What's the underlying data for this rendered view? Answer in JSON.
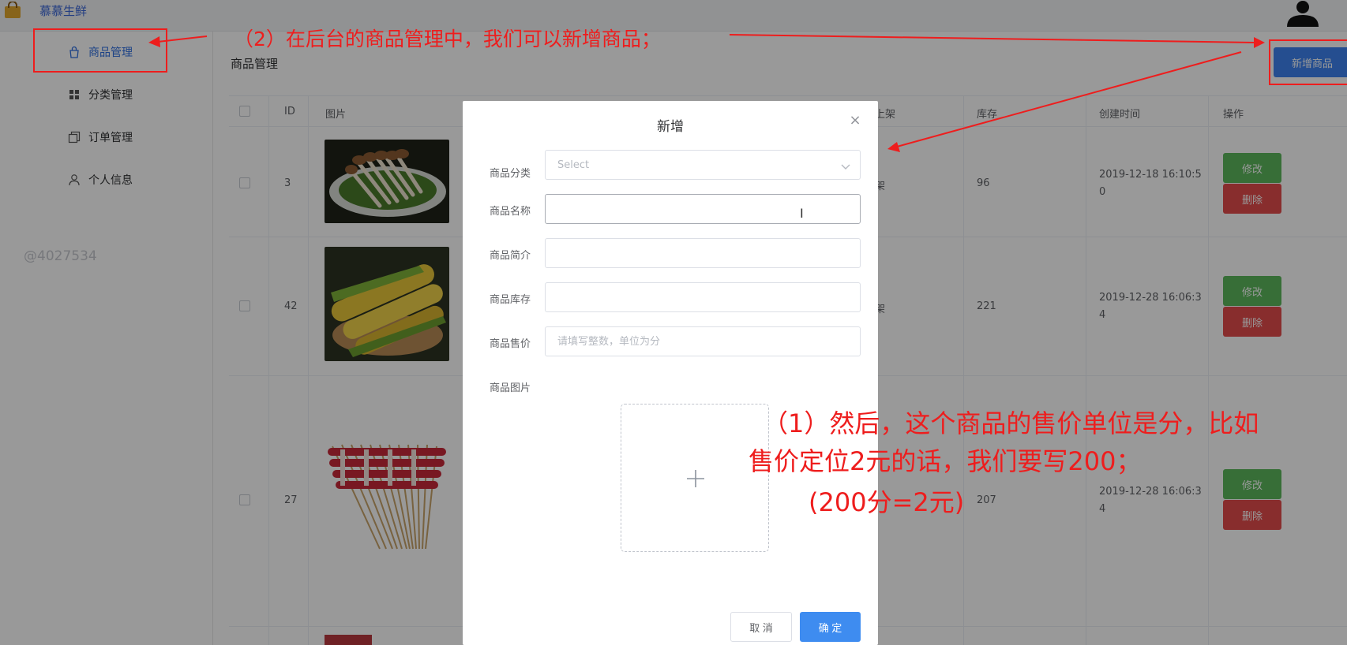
{
  "app": {
    "title": "慕慕生鲜"
  },
  "sidebar": {
    "items": [
      {
        "label": "商品管理",
        "icon": "bag-icon"
      },
      {
        "label": "分类管理",
        "icon": "grid-icon"
      },
      {
        "label": "订单管理",
        "icon": "copy-icon"
      },
      {
        "label": "个人信息",
        "icon": "user-icon"
      }
    ],
    "watermark": "@4027534"
  },
  "main": {
    "title": "商品管理",
    "add_button": "新增商品",
    "columns": [
      "ID",
      "图片",
      "上架",
      "库存",
      "创建时间",
      "操作"
    ],
    "rows": [
      {
        "id": "3",
        "status": "架",
        "stock": "96",
        "created": "2019-12-18 16:10:50",
        "created_lines": [
          "2019-12-18 16:10:5",
          "0"
        ]
      },
      {
        "id": "42",
        "status": "架",
        "stock": "221",
        "created": "2019-12-28 16:06:34",
        "created_lines": [
          "2019-12-28 16:06:3",
          "4"
        ]
      },
      {
        "id": "27",
        "status": "",
        "stock": "207",
        "created": "2019-12-28 16:06:34",
        "created_lines": [
          "2019-12-28 16:06:3",
          "4"
        ]
      }
    ],
    "edit_label": "修改",
    "delete_label": "删除"
  },
  "dialog": {
    "title": "新增",
    "fields": {
      "category": {
        "label": "商品分类",
        "placeholder": "Select"
      },
      "name": {
        "label": "商品名称",
        "value": ""
      },
      "desc": {
        "label": "商品简介",
        "value": ""
      },
      "stock": {
        "label": "商品库存",
        "value": ""
      },
      "price": {
        "label": "商品售价",
        "placeholder": "请填写整数，单位为分"
      },
      "image": {
        "label": "商品图片"
      }
    },
    "cancel": "取 消",
    "confirm": "确 定"
  },
  "annotations": {
    "top": "（2）在后台的商品管理中，我们可以新增商品；",
    "bottom_line1": "（1）然后，这个商品的售价单位是分，比如",
    "bottom_line2": "售价定位2元的话，我们要写200；",
    "bottom_line3": "(200分=2元)"
  },
  "colors": {
    "primary": "#3e83f0",
    "success": "#5cb85c",
    "danger": "#e34b4b",
    "annotation": "#ee1d1d"
  }
}
